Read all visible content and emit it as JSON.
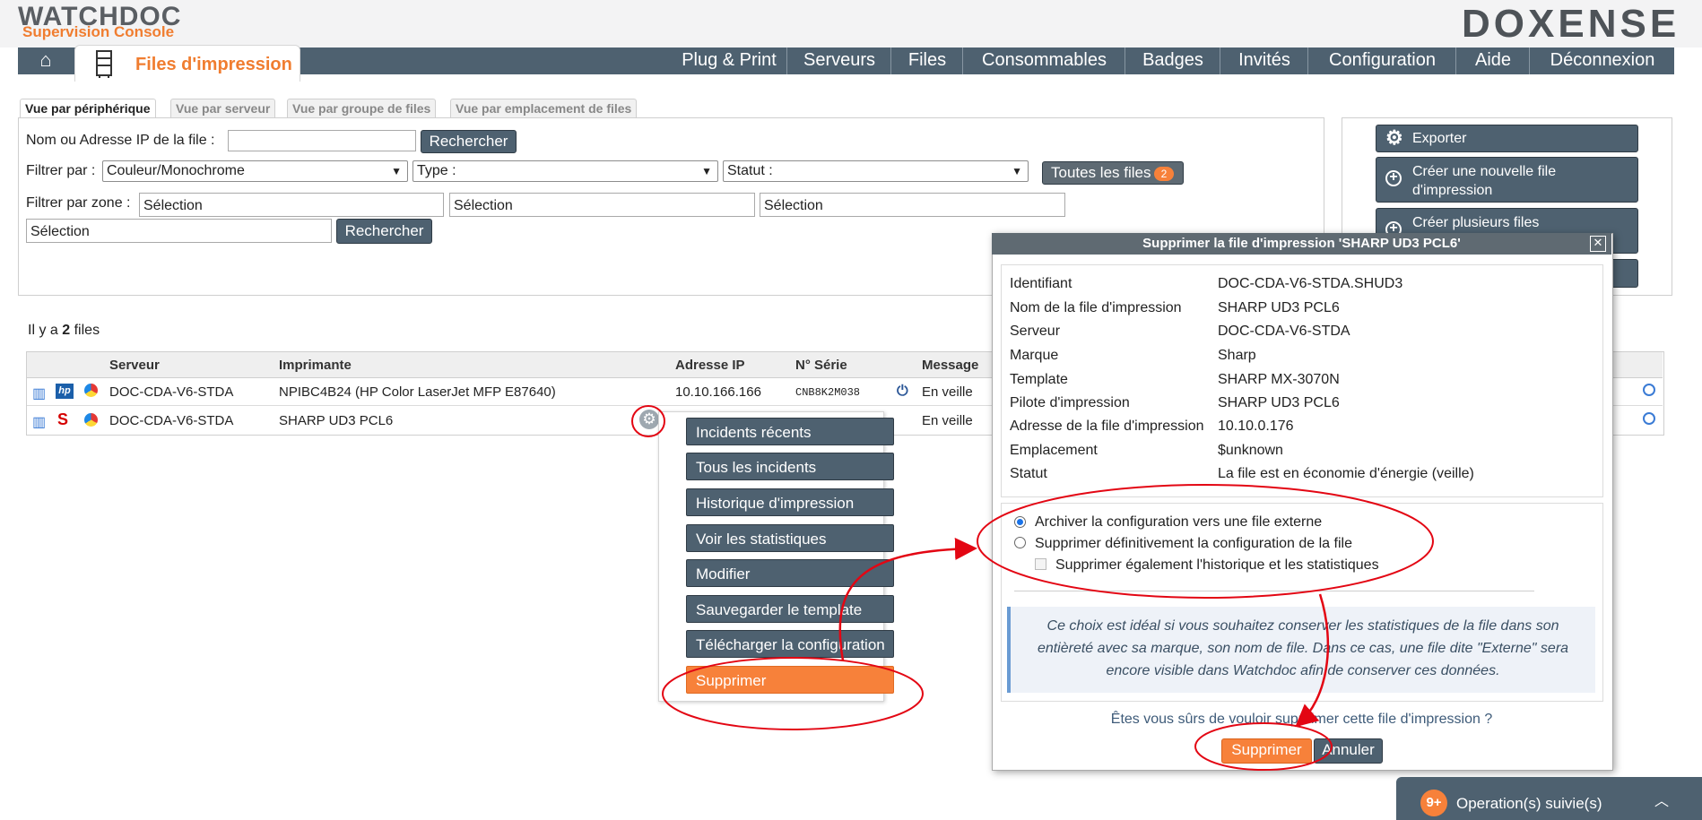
{
  "brand": {
    "logo": "WATCHDOC",
    "subtitle": "Supervision Console",
    "vendor": "DOXENSE"
  },
  "nav": {
    "items": [
      "Plug & Print",
      "Serveurs",
      "Files",
      "Consommables",
      "Badges",
      "Invités",
      "Configuration",
      "Aide",
      "Déconnexion"
    ]
  },
  "page": {
    "tab_label": "Files d'impression"
  },
  "subtabs": [
    "Vue par périphérique",
    "Vue par serveur",
    "Vue par groupe de files",
    "Vue par emplacement de files"
  ],
  "filters": {
    "name_label": "Nom ou Adresse IP de la file :",
    "name_value": "",
    "search_button": "Rechercher",
    "filter_by_label": "Filtrer par :",
    "color_select": "Couleur/Monochrome",
    "type_select": "Type :",
    "status_select": "Statut :",
    "all_files_label": "Toutes les files",
    "all_files_count": "2",
    "zone_label": "Filtrer par zone :",
    "zone_values": [
      "Sélection",
      "Sélection",
      "Sélection",
      "Sélection"
    ],
    "search_button_2": "Rechercher"
  },
  "actions": {
    "export": "Exporter",
    "create_one": "Créer une nouvelle file d'impression",
    "create_many": "Créer plusieurs files"
  },
  "summary": {
    "prefix": "Il y a",
    "count": "2",
    "suffix": "files"
  },
  "table": {
    "headers": {
      "server": "Serveur",
      "printer": "Imprimante",
      "ip": "Adresse IP",
      "serial": "N° Série",
      "message": "Message"
    },
    "rows": [
      {
        "server": "DOC-CDA-V6-STDA",
        "printer": "NPIBC4B24 (HP Color LaserJet MFP E87640)",
        "ip": "10.10.166.166",
        "serial": "CNB8K2M038",
        "message": "En veille"
      },
      {
        "server": "DOC-CDA-V6-STDA",
        "printer": "SHARP UD3 PCL6",
        "ip": "",
        "serial": "",
        "message": "En veille"
      }
    ]
  },
  "context_menu": {
    "items": [
      "Incidents récents",
      "Tous les incidents",
      "Historique d'impression",
      "Voir les statistiques",
      "Modifier",
      "Sauvegarder le template",
      "Télécharger la configuration",
      "Supprimer"
    ]
  },
  "dialog": {
    "title": "Supprimer la file d'impression 'SHARP UD3 PCL6'",
    "close": "✕",
    "fields": [
      {
        "key": "Identifiant",
        "value": "DOC-CDA-V6-STDA.SHUD3"
      },
      {
        "key": "Nom de la file d'impression",
        "value": "SHARP UD3 PCL6"
      },
      {
        "key": "Serveur",
        "value": "DOC-CDA-V6-STDA"
      },
      {
        "key": "Marque",
        "value": "Sharp"
      },
      {
        "key": "Template",
        "value": "SHARP MX-3070N"
      },
      {
        "key": "Pilote d'impression",
        "value": "SHARP UD3 PCL6"
      },
      {
        "key": "Adresse de la file d'impression",
        "value": "10.10.0.176"
      },
      {
        "key": "Emplacement",
        "value": "$unknown"
      },
      {
        "key": "Statut",
        "value": "La file est en économie d'énergie (veille)"
      }
    ],
    "option_archive": "Archiver la configuration vers une file externe",
    "option_delete": "Supprimer définitivement la configuration de la file",
    "option_history": "Supprimer également l'historique et les statistiques",
    "hint": "Ce choix est idéal si vous souhaitez conserver les statistiques de la file dans son entièreté avec sa marque, son nom de file. Dans ce cas, une file dite \"Externe\" sera encore visible dans Watchdoc afin de conserver ces données.",
    "question": "Êtes vous sûrs de vouloir supprimer cette file d'impression ?",
    "confirm": "Supprimer",
    "cancel": "Annuler"
  },
  "operations": {
    "badge": "9+",
    "label": "Operation(s) suivie(s)"
  },
  "colors": {
    "accent": "#f7813a",
    "nav": "#4e6170",
    "annotation": "#e30613"
  }
}
